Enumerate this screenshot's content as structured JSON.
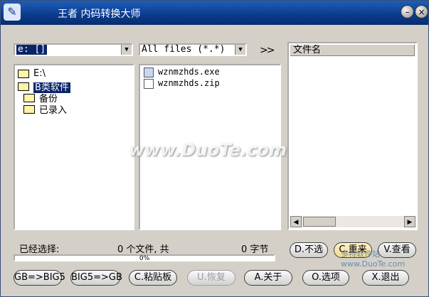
{
  "window": {
    "title": "王者  内码转换大师",
    "app_icon": "tools-icon",
    "min_glyph": "–",
    "close_glyph": "×"
  },
  "drive_select": {
    "value": "e: []",
    "arrow_glyph": "▼"
  },
  "filter_select": {
    "value": "All files (*.*)",
    "arrow_glyph": "▼"
  },
  "add_glyph": ">>",
  "tree": [
    {
      "label": "E:\\",
      "selected": false
    },
    {
      "label": "B类软件",
      "selected": true
    },
    {
      "label": "备份",
      "selected": false
    },
    {
      "label": "已录入",
      "selected": false
    }
  ],
  "files": [
    {
      "name": "wznmzhds.exe",
      "icon": "exe-icon"
    },
    {
      "name": "wznmzhds.zip",
      "icon": "file-icon"
    }
  ],
  "right_panel": {
    "header": "文件名",
    "scroll_left": "◀",
    "scroll_right": "▶"
  },
  "status": {
    "selected_label": "已经选择:",
    "file_count": "0 个文件, 共",
    "bytes": "0 字节",
    "progress": "0%"
  },
  "buttons": {
    "unselect": "D.不选",
    "redo": "C.重来",
    "view": "V.查看",
    "gb_to_big5": "GB=>BIG5",
    "big5_to_gb": "BIG5=>GB",
    "clipboard": "C.粘贴板",
    "restore": "U.恢复",
    "about": "A.关于",
    "options": "O.选项",
    "exit": "X.退出"
  },
  "watermark": {
    "main": "www.DuoTe.com",
    "corner": "多特软件站 www.DuoTe.com"
  }
}
